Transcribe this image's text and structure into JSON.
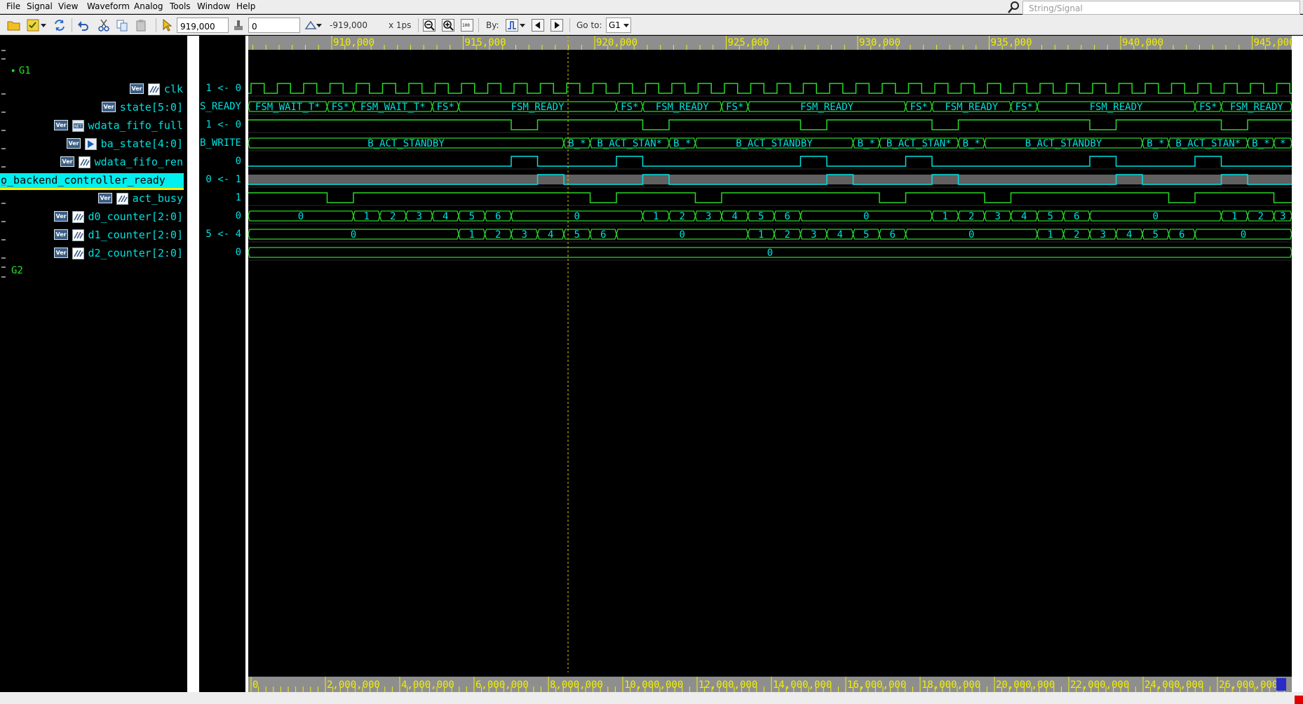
{
  "menu": {
    "file": "File",
    "signal": "Signal",
    "view": "View",
    "waveform": "Waveform",
    "analog": "Analog",
    "tools": "Tools",
    "window": "Window",
    "help": "Help"
  },
  "search": {
    "placeholder": "String/Signal"
  },
  "toolbar": {
    "cursor_time": "919,000",
    "marker_time": "0",
    "delta_time": "-919,000",
    "time_unit": "x 1ps",
    "by_label": "By:",
    "goto_label": "Go to:",
    "goto_value": "G1"
  },
  "groups": {
    "g1": "G1",
    "g2": "G2"
  },
  "signals": [
    {
      "name": "clk",
      "value": "0 -> 1",
      "icon": "ver-badge+clock-icon"
    },
    {
      "name": "state[5:0]",
      "value": "S_READY",
      "icon": "ver-badge"
    },
    {
      "name": "wdata_fifo_full",
      "value": "0 -> 1",
      "icon": "ver-badge+net-icon"
    },
    {
      "name": "ba_state[4:0]",
      "value": "B_WRITE",
      "icon": "ver-badge+port-icon"
    },
    {
      "name": "wdata_fifo_ren",
      "value": "0",
      "icon": "ver-badge+reg-icon"
    },
    {
      "name": "o_backend_controller_ready",
      "value": "1 -> 0",
      "icon": "none",
      "selected": true
    },
    {
      "name": "act_busy",
      "value": "1",
      "icon": "ver-badge+reg-icon"
    },
    {
      "name": "d0_counter[2:0]",
      "value": "0",
      "icon": "ver-badge+reg-icon"
    },
    {
      "name": "d1_counter[2:0]",
      "value": "4 -> 5",
      "icon": "ver-badge+reg-icon"
    },
    {
      "name": "d2_counter[2:0]",
      "value": "0",
      "icon": "ver-badge+reg-icon"
    }
  ],
  "timeline": {
    "ticks": [
      "910,000",
      "915,000",
      "920,000",
      "925,000",
      "930,000",
      "935,000",
      "940,000",
      "945,000"
    ],
    "overview_ticks": [
      "0",
      "2,000,000",
      "4,000,000",
      "6,000,000",
      "8,000,000",
      "10,000,000",
      "12,000,000",
      "14,000,000",
      "16,000,000",
      "18,000,000",
      "20,000,000",
      "22,000,000",
      "24,000,000",
      "26,000,000"
    ]
  },
  "waves": {
    "state_segments": [
      {
        "t": 0,
        "label": "FSM_WAIT_T*"
      },
      {
        "t": 3,
        "label": "FS*"
      },
      {
        "t": 4,
        "label": "FSM_WAIT_T*"
      },
      {
        "t": 7,
        "label": "FS*"
      },
      {
        "t": 8,
        "label": "FSM_READY"
      },
      {
        "t": 14,
        "label": "FS*"
      },
      {
        "t": 15,
        "label": "FSM_READY"
      },
      {
        "t": 18,
        "label": "FS*"
      },
      {
        "t": 19,
        "label": "FSM_READY"
      },
      {
        "t": 25,
        "label": "FS*"
      },
      {
        "t": 26,
        "label": "FSM_READY"
      },
      {
        "t": 29,
        "label": "FS*"
      },
      {
        "t": 30,
        "label": "FSM_READY"
      },
      {
        "t": 36,
        "label": "FS*"
      },
      {
        "t": 37,
        "label": "FSM_READY"
      }
    ],
    "ba_segments": [
      {
        "t": 0,
        "label": "B_ACT_STANDBY"
      },
      {
        "t": 12,
        "label": "B_*"
      },
      {
        "t": 13,
        "label": "B_ACT_STAN*"
      },
      {
        "t": 16,
        "label": "B_*"
      },
      {
        "t": 17,
        "label": "B_ACT_STANDBY"
      },
      {
        "t": 23,
        "label": "B_*"
      },
      {
        "t": 24,
        "label": "B_ACT_STAN*"
      },
      {
        "t": 27,
        "label": "B_*"
      },
      {
        "t": 28,
        "label": "B_ACT_STANDBY"
      },
      {
        "t": 34,
        "label": "B_*"
      },
      {
        "t": 35,
        "label": "B_ACT_STAN*"
      },
      {
        "t": 38,
        "label": "B_*"
      },
      {
        "t": 39,
        "label": "*"
      }
    ],
    "d0_segments": [
      {
        "t": 0,
        "label": "0"
      },
      {
        "t": 4,
        "label": "1"
      },
      {
        "t": 5,
        "label": "2"
      },
      {
        "t": 6,
        "label": "3"
      },
      {
        "t": 7,
        "label": "4"
      },
      {
        "t": 8,
        "label": "5"
      },
      {
        "t": 9,
        "label": "6"
      },
      {
        "t": 10,
        "label": "0"
      },
      {
        "t": 15,
        "label": "1"
      },
      {
        "t": 16,
        "label": "2"
      },
      {
        "t": 17,
        "label": "3"
      },
      {
        "t": 18,
        "label": "4"
      },
      {
        "t": 19,
        "label": "5"
      },
      {
        "t": 20,
        "label": "6"
      },
      {
        "t": 21,
        "label": "0"
      },
      {
        "t": 26,
        "label": "1"
      },
      {
        "t": 27,
        "label": "2"
      },
      {
        "t": 28,
        "label": "3"
      },
      {
        "t": 29,
        "label": "4"
      },
      {
        "t": 30,
        "label": "5"
      },
      {
        "t": 31,
        "label": "6"
      },
      {
        "t": 32,
        "label": "0"
      },
      {
        "t": 37,
        "label": "1"
      },
      {
        "t": 38,
        "label": "2"
      },
      {
        "t": 39,
        "label": "3"
      }
    ],
    "d1_segments": [
      {
        "t": 0,
        "label": "0"
      },
      {
        "t": 8,
        "label": "1"
      },
      {
        "t": 9,
        "label": "2"
      },
      {
        "t": 10,
        "label": "3"
      },
      {
        "t": 11,
        "label": "4"
      },
      {
        "t": 12,
        "label": "5"
      },
      {
        "t": 13,
        "label": "6"
      },
      {
        "t": 14,
        "label": "0"
      },
      {
        "t": 19,
        "label": "1"
      },
      {
        "t": 20,
        "label": "2"
      },
      {
        "t": 21,
        "label": "3"
      },
      {
        "t": 22,
        "label": "4"
      },
      {
        "t": 23,
        "label": "5"
      },
      {
        "t": 24,
        "label": "6"
      },
      {
        "t": 25,
        "label": "0"
      },
      {
        "t": 30,
        "label": "1"
      },
      {
        "t": 31,
        "label": "2"
      },
      {
        "t": 32,
        "label": "3"
      },
      {
        "t": 33,
        "label": "4"
      },
      {
        "t": 34,
        "label": "5"
      },
      {
        "t": 35,
        "label": "6"
      },
      {
        "t": 36,
        "label": "0"
      }
    ],
    "d2_segments": [
      {
        "t": 0,
        "label": "0"
      }
    ],
    "full_pulses": [
      [
        11,
        12
      ],
      [
        15,
        16
      ],
      [
        22,
        23
      ],
      [
        26,
        27
      ],
      [
        33,
        34
      ],
      [
        37,
        38
      ]
    ],
    "ren_pulses": [
      [
        10,
        11
      ],
      [
        14,
        15
      ],
      [
        21,
        22
      ],
      [
        25,
        26
      ],
      [
        32,
        33
      ],
      [
        36,
        37
      ]
    ],
    "ready_low": [
      [
        11,
        12
      ],
      [
        15,
        16
      ],
      [
        22,
        23
      ],
      [
        26,
        27
      ],
      [
        33,
        34
      ],
      [
        37,
        38
      ]
    ],
    "busy_low": [
      [
        3,
        4
      ],
      [
        13,
        14
      ],
      [
        17,
        18
      ],
      [
        24,
        25
      ],
      [
        28,
        29
      ],
      [
        35,
        36
      ],
      [
        39,
        40
      ]
    ]
  },
  "colors": {
    "wave_green": "#28d828",
    "wave_cyan": "#00e0e0",
    "axis_yellow": "#f0f000",
    "selected_row_fill": "#606060",
    "cursor": "#e0c000"
  }
}
